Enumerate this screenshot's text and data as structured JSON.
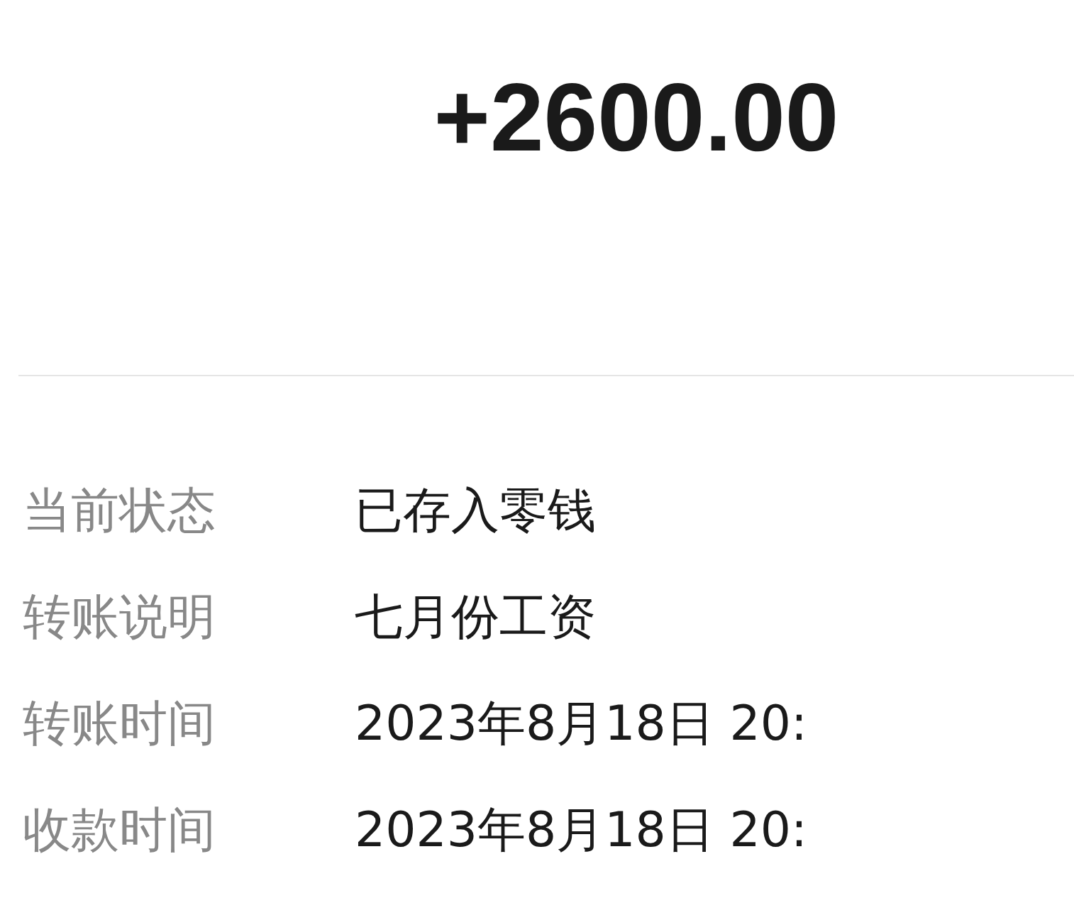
{
  "amount": "+2600.00",
  "details": [
    {
      "label": "当前状态",
      "value": "已存入零钱"
    },
    {
      "label": "转账说明",
      "value": "七月份工资"
    },
    {
      "label": "转账时间",
      "value": "2023年8月18日 20:"
    },
    {
      "label": "收款时间",
      "value": "2023年8月18日 20:"
    }
  ]
}
